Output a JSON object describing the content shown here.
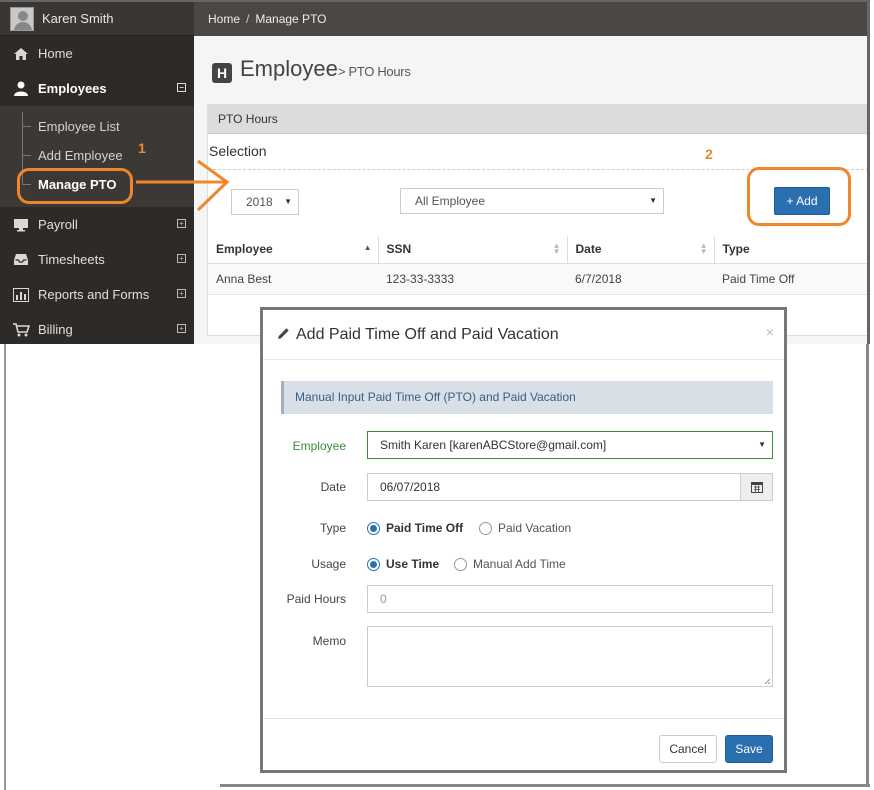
{
  "user": {
    "name": "Karen Smith"
  },
  "sidebar": {
    "items": [
      {
        "label": "Home",
        "icon": "home-icon"
      },
      {
        "label": "Employees",
        "icon": "user-icon"
      },
      {
        "label": "Payroll",
        "icon": "monitor-icon"
      },
      {
        "label": "Timesheets",
        "icon": "inbox-icon"
      },
      {
        "label": "Reports and Forms",
        "icon": "chart-icon"
      },
      {
        "label": "Billing",
        "icon": "cart-icon"
      }
    ],
    "employee_sub": [
      "Employee List",
      "Add Employee",
      "Manage PTO"
    ],
    "collapse_symbol": "⊟",
    "expand_symbol": "⊞"
  },
  "breadcrumb": {
    "home": "Home",
    "sep": "/",
    "current": "Manage PTO"
  },
  "page": {
    "icon_letter": "H",
    "title": "Employee",
    "subtitle": "> PTO Hours"
  },
  "panel": {
    "title": "PTO Hours",
    "selection_title": "Selection",
    "year_value": "2018",
    "employee_filter": "All Employee",
    "add_label": "+ Add"
  },
  "table": {
    "headers": [
      "Employee",
      "SSN",
      "Date",
      "Type"
    ],
    "rows": [
      [
        "Anna Best",
        "123-33-3333",
        "6/7/2018",
        "Paid Time Off"
      ]
    ]
  },
  "annotations": {
    "step1": "1",
    "step2": "2",
    "accent": "#f0862a"
  },
  "modal": {
    "title": "Add Paid Time Off and Paid Vacation",
    "close": "×",
    "info": "Manual Input Paid Time Off (PTO) and Paid Vacation",
    "employee_label": "Employee",
    "employee_value": "Smith Karen [karenABCStore@gmail.com]",
    "date_label": "Date",
    "date_value": "06/07/2018",
    "type_label": "Type",
    "type_options": [
      "Paid Time Off",
      "Paid Vacation"
    ],
    "usage_label": "Usage",
    "usage_options": [
      "Use Time",
      "Manual Add Time"
    ],
    "hours_label": "Paid Hours",
    "hours_placeholder": "0",
    "memo_label": "Memo",
    "cancel_label": "Cancel",
    "save_label": "Save"
  },
  "colors": {
    "primary": "#2a6fb0",
    "sidebar": "#2d2a28",
    "employee_label": "#3c8a3c"
  }
}
